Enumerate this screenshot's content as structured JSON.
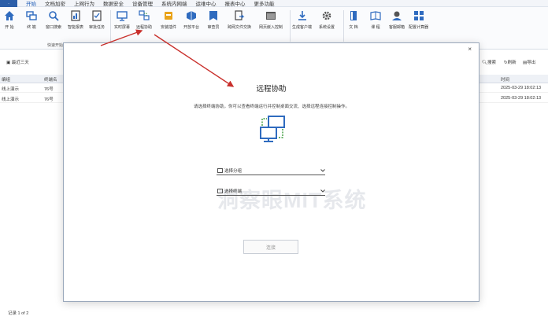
{
  "menubar": {
    "logo": "ㆍ",
    "items": [
      "开始",
      "文档加密",
      "上网行为",
      "数据安全",
      "设备管理",
      "系统内网端",
      "运维中心",
      "报表中心",
      "更多功能"
    ],
    "active_index": 0
  },
  "ribbon": {
    "buttons": [
      {
        "label": "开 始",
        "icon": "home-icon"
      },
      {
        "label": "终 端",
        "icon": "terminal-icon"
      },
      {
        "label": "窗口搜索",
        "icon": "search-icon"
      },
      {
        "label": "智能报表",
        "icon": "report-icon"
      },
      {
        "label": "审批任务",
        "icon": "approval-icon"
      },
      {
        "label": "实时屏幕",
        "icon": "monitor-icon"
      },
      {
        "label": "远程协助",
        "icon": "remote-assist-icon"
      },
      {
        "label": "安装插件",
        "icon": "plugin-icon"
      },
      {
        "label": "开放平台",
        "icon": "platform-icon"
      },
      {
        "label": "审查员",
        "icon": "auditor-icon"
      },
      {
        "label": "跨网文件交换",
        "icon": "file-exchange-icon"
      },
      {
        "label": "网页嵌入控制",
        "icon": "web-embed-icon"
      },
      {
        "label": "生成客户端",
        "icon": "download-icon"
      },
      {
        "label": "系统设置",
        "icon": "gear-icon"
      },
      {
        "label": "文 档",
        "icon": "doc-icon"
      },
      {
        "label": "课 程",
        "icon": "course-icon"
      },
      {
        "label": "客服邮箱",
        "icon": "support-icon"
      },
      {
        "label": "配置计算器",
        "icon": "calculator-icon"
      }
    ],
    "group_caption": "快速开始"
  },
  "toolbar2": {
    "left": "最近三天",
    "search": "搜索",
    "refresh": "刷新",
    "export": "导出"
  },
  "table": {
    "headers": [
      "编组",
      "终端名",
      "时间"
    ],
    "rows": [
      {
        "c1": "线上演示",
        "c2": "76号",
        "time": "2025-03-29 18:02:13"
      },
      {
        "c1": "线上演示",
        "c2": "76号",
        "time": "2025-03-29 18:02:13"
      }
    ]
  },
  "footer": "记录 1 of 2",
  "dialog": {
    "close": "×",
    "title": "远程协助",
    "description": "请选择终端协助，你可以查看终端运行并控制桌面交流、选择远程连接控制操作。",
    "group_select": "选择分组",
    "terminal_select": "选择终端",
    "watermark": "洞察眼MIT系统",
    "connect_button": "连接"
  },
  "colors": {
    "accent": "#1b59b5",
    "arrow": "#c9302c"
  }
}
